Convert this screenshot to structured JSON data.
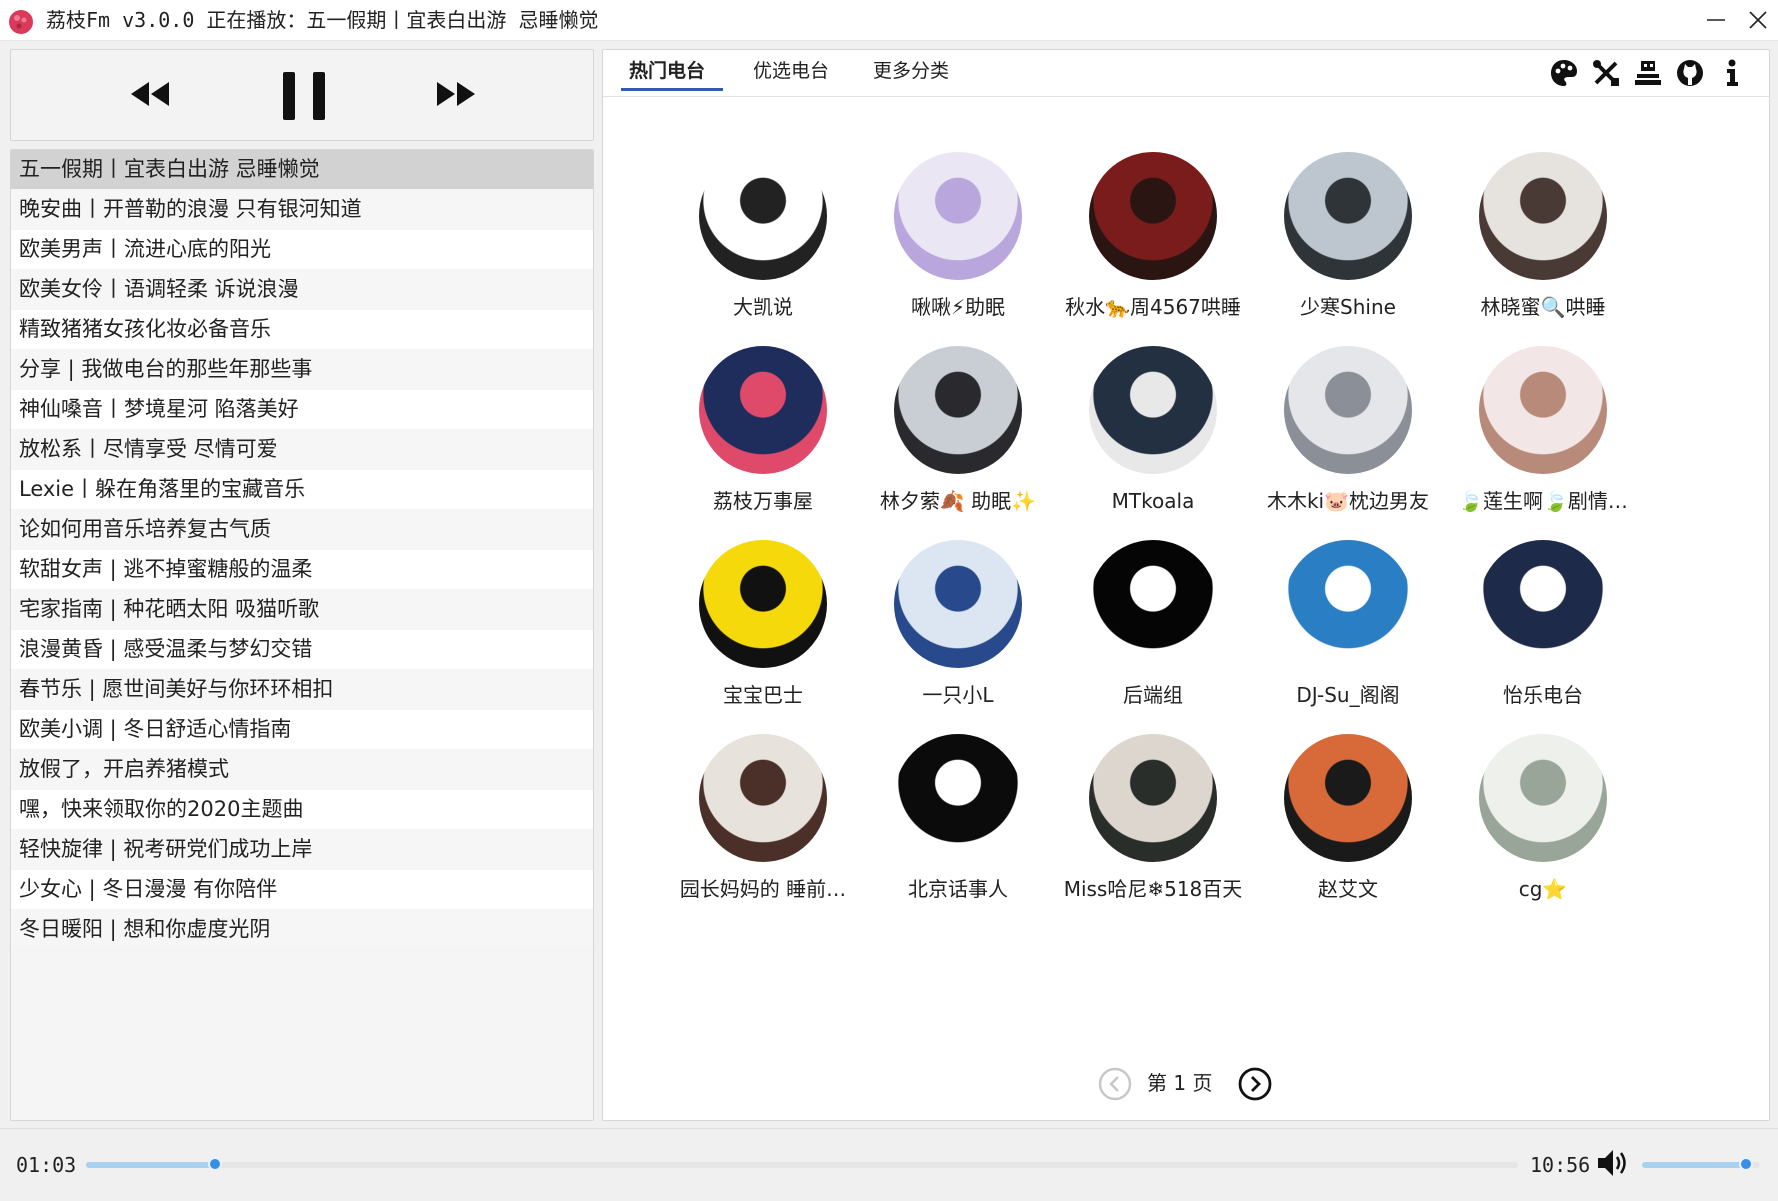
{
  "window": {
    "title": "荔枝Fm v3.0.0 正在播放：五一假期丨宜表白出游 忌睡懒觉"
  },
  "player": {
    "prev_icon": "rewind-icon",
    "pause_icon": "pause-icon",
    "next_icon": "fast-forward-icon",
    "current_time": "01:03",
    "total_time": "10:56",
    "progress": 0.09,
    "volume": 0.88
  },
  "playlist": [
    "五一假期丨宜表白出游 忌睡懒觉",
    "晚安曲丨开普勒的浪漫 只有银河知道",
    "欧美男声丨流进心底的阳光",
    "欧美女伶丨语调轻柔 诉说浪漫",
    "精致猪猪女孩化妆必备音乐",
    "分享 | 我做电台的那些年那些事",
    "神仙嗓音丨梦境星河 陷落美好",
    "放松系丨尽情享受 尽情可爱",
    "Lexie丨躲在角落里的宝藏音乐",
    "论如何用音乐培养复古气质",
    "软甜女声 | 逃不掉蜜糖般的温柔",
    "宅家指南 | 种花晒太阳 吸猫听歌",
    "浪漫黄昏 | 感受温柔与梦幻交错",
    "春节乐 | 愿世间美好与你环环相扣",
    "欧美小调 | 冬日舒适心情指南",
    "放假了，开启养猪模式",
    "嘿，快来领取你的2020主题曲",
    "轻快旋律 | 祝考研党们成功上岸",
    "少女心 | 冬日漫漫 有你陪伴",
    "冬日暖阳 | 想和你虚度光阴"
  ],
  "tabs": [
    "热门电台",
    "优选电台",
    "更多分类"
  ],
  "toolbar_icons": [
    "palette-icon",
    "tools-icon",
    "pixel-icon",
    "github-icon",
    "info-icon"
  ],
  "stations": [
    {
      "name": "大凯说",
      "avatar": [
        "#ffffff",
        "#222222"
      ]
    },
    {
      "name": "啾啾⚡助眠",
      "avatar": [
        "#ebe6f4",
        "#b9a6dc"
      ]
    },
    {
      "name": "秋水🐆周4567哄睡",
      "avatar": [
        "#7a1c1c",
        "#2a1512"
      ]
    },
    {
      "name": "少寒Shine",
      "avatar": [
        "#bdc6cf",
        "#2e3438"
      ]
    },
    {
      "name": "林晓蜜🔍哄睡",
      "avatar": [
        "#e6e2de",
        "#4a3a35"
      ]
    },
    {
      "name": "荔枝万事屋",
      "avatar": [
        "#1f2d5c",
        "#e04a6a"
      ]
    },
    {
      "name": "林夕萦🍂 助眠✨",
      "avatar": [
        "#c9ced4",
        "#2a2a2e"
      ]
    },
    {
      "name": "MTkoala",
      "avatar": [
        "#233041",
        "#e8e8e8"
      ]
    },
    {
      "name": "木木ki🐷枕边男友",
      "avatar": [
        "#e4e6ea",
        "#8a8f98"
      ]
    },
    {
      "name": "🍃莲生啊🍃剧情…",
      "avatar": [
        "#f2e6e6",
        "#b88a7a"
      ]
    },
    {
      "name": "宝宝巴士",
      "avatar": [
        "#f5d90a",
        "#111111"
      ]
    },
    {
      "name": "一只小L",
      "avatar": [
        "#dce6f2",
        "#284a8c"
      ]
    },
    {
      "name": "后端组",
      "avatar": [
        "#050505",
        "#ffffff"
      ]
    },
    {
      "name": "DJ-Su_阁阁",
      "avatar": [
        "#2a7fc4",
        "#ffffff"
      ]
    },
    {
      "name": "怡乐电台",
      "avatar": [
        "#1d2a4a",
        "#ffffff"
      ]
    },
    {
      "name": "园长妈妈的 睡前…",
      "avatar": [
        "#e8e2dc",
        "#4a3028"
      ]
    },
    {
      "name": "北京话事人",
      "avatar": [
        "#0b0b0b",
        "#ffffff"
      ]
    },
    {
      "name": "Miss哈尼❄518百天",
      "avatar": [
        "#dcd6cf",
        "#2a2e2a"
      ]
    },
    {
      "name": "赵艾文",
      "avatar": [
        "#d86a3a",
        "#1a1a1a"
      ]
    },
    {
      "name": "cg⭐",
      "avatar": [
        "#eef0ec",
        "#9aa59a"
      ]
    }
  ],
  "pagination": {
    "label": "第 1 页",
    "prev_icon": "chevron-left-icon",
    "next_icon": "chevron-right-icon"
  },
  "colors": {
    "accent": "#3a8ee6",
    "progress_fill": "#a8d1ef",
    "active_row": "#d2d2d2"
  }
}
